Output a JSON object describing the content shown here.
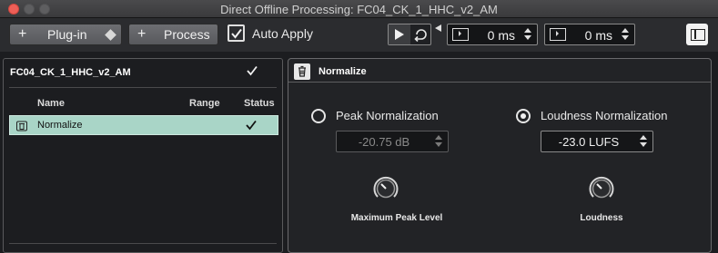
{
  "window": {
    "title": "Direct Offline Processing: FC04_CK_1_HHC_v2_AM"
  },
  "toolbar": {
    "plugin_label": "Plug-in",
    "process_label": "Process",
    "auto_apply_label": "Auto Apply",
    "auto_apply_checked": true,
    "time_start": "0 ms",
    "time_end": "0 ms"
  },
  "left_panel": {
    "clip_name": "FC04_CK_1_HHC_v2_AM",
    "columns": [
      "Name",
      "Range",
      "Status"
    ],
    "rows": [
      {
        "name": "Normalize",
        "range": "",
        "status": "✓"
      }
    ]
  },
  "right_panel": {
    "title": "Normalize",
    "peak": {
      "label": "Peak Normalization",
      "value": "-20.75 dB",
      "selected": false,
      "knob_label": "Maximum Peak Level"
    },
    "loudness": {
      "label": "Loudness Normalization",
      "value": "-23.0 LUFS",
      "selected": true,
      "knob_label": "Loudness"
    }
  },
  "colors": {
    "selected_row": "#a9d5c7",
    "close_button": "#ee5f57"
  }
}
